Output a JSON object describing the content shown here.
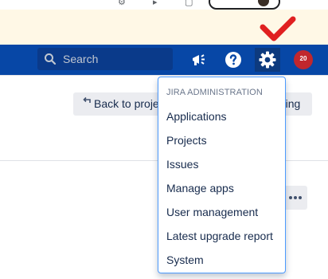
{
  "header": {
    "search_placeholder": "Search"
  },
  "avatar": {
    "text": "20"
  },
  "toolbar": {
    "back_label": "Back to proje",
    "config_label": "ring"
  },
  "admin_menu": {
    "heading": "JIRA ADMINISTRATION",
    "items": [
      "Applications",
      "Projects",
      "Issues",
      "Manage apps",
      "User management",
      "Latest upgrade report",
      "System"
    ]
  },
  "colors": {
    "header_bg": "#0747a6",
    "banner_bg": "#fff8e6",
    "dropdown_border": "#4c9aff",
    "annotation": "#e02020"
  }
}
